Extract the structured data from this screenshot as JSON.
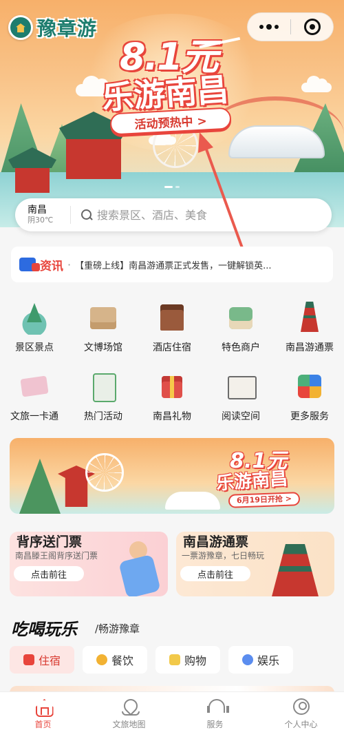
{
  "header": {
    "logo_text": "豫章游"
  },
  "hero": {
    "price": "8.1元",
    "title": "乐游南昌",
    "button": "活动预热中 >"
  },
  "search": {
    "city": "南昌",
    "weather": "阴30℃",
    "placeholder": "搜索景区、酒店、美食"
  },
  "news": {
    "label": "资讯",
    "separator": "·",
    "text": "【重磅上线】南昌游通票正式发售，一键解锁英..."
  },
  "grid": [
    {
      "label": "景区景点",
      "icon": "scenic-spot-icon"
    },
    {
      "label": "文博场馆",
      "icon": "museum-icon"
    },
    {
      "label": "酒店住宿",
      "icon": "hotel-icon"
    },
    {
      "label": "特色商户",
      "icon": "merchant-icon"
    },
    {
      "label": "南昌游通票",
      "icon": "pass-ticket-icon"
    },
    {
      "label": "文旅一卡通",
      "icon": "card-icon"
    },
    {
      "label": "热门活动",
      "icon": "calendar-icon"
    },
    {
      "label": "南昌礼物",
      "icon": "gift-icon"
    },
    {
      "label": "阅读空间",
      "icon": "book-icon"
    },
    {
      "label": "更多服务",
      "icon": "puzzle-icon"
    }
  ],
  "banner2": {
    "price": "8.1元",
    "title": "乐游南昌",
    "button": "6月19日开抢 >"
  },
  "cards": [
    {
      "title": "背序送门票",
      "sub": "南昌滕王阁背序送门票",
      "button": "点击前往"
    },
    {
      "title": "南昌游通票",
      "sub": "一票游豫章，七日畅玩",
      "button": "点击前往"
    }
  ],
  "section": {
    "title": "吃喝玩乐",
    "subtitle": "/畅游豫章"
  },
  "pills": [
    {
      "label": "住宿",
      "active": true
    },
    {
      "label": "餐饮",
      "active": false
    },
    {
      "label": "购物",
      "active": false
    },
    {
      "label": "娱乐",
      "active": false
    }
  ],
  "tabbar": [
    {
      "label": "首页",
      "icon": "home-icon",
      "active": true
    },
    {
      "label": "文旅地图",
      "icon": "map-icon",
      "active": false
    },
    {
      "label": "服务",
      "icon": "service-icon",
      "active": false
    },
    {
      "label": "个人中心",
      "icon": "user-icon",
      "active": false
    }
  ],
  "colors": {
    "accent": "#e8453c",
    "brand": "#1d7d6e"
  }
}
